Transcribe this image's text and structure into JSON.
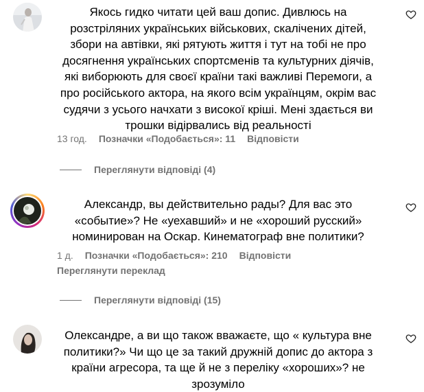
{
  "comments": [
    {
      "text": "Якось гидко читати цей ваш допис. Дивлюсь на розстріляних українських військових, скалічених дітей, збори на автівки, які рятують життя і тут на тобі не про досягнення українських спортсменів та культурних діячів, які виборюють для своєї країни такі важливі Перемоги, а про російського актора, на якого всім українцям, окрім вас судячи з усього начхати з високої кріші. Мені здається ви трошки відірвались від реальності",
      "time": "13 год.",
      "likes": "Позначки «Подобається»: 11",
      "reply": "Відповісти",
      "view_replies": "Переглянути відповіді (4)"
    },
    {
      "text": "Александр, вы действительно рады? Для вас это «событие»? Не «уехавший» и не «хороший русский» номинирован на Оскар. Кинематограф вне политики?",
      "time": "1 д.",
      "likes": "Позначки «Подобається»: 210",
      "reply": "Відповісти",
      "translate": "Переглянути переклад",
      "view_replies": "Переглянути відповіді (15)"
    },
    {
      "text": "Олександре, а ви що також вважаєте, що « культура вне политики?» Чи що це за такий дружній допис до актора з країни агресора, та ще й не з переліку «хороших»? не зрозуміло"
    }
  ],
  "icons": {
    "like": "heart-outline-icon"
  },
  "colors": {
    "meta_text": "#737373",
    "story_ring": "#d62976"
  }
}
